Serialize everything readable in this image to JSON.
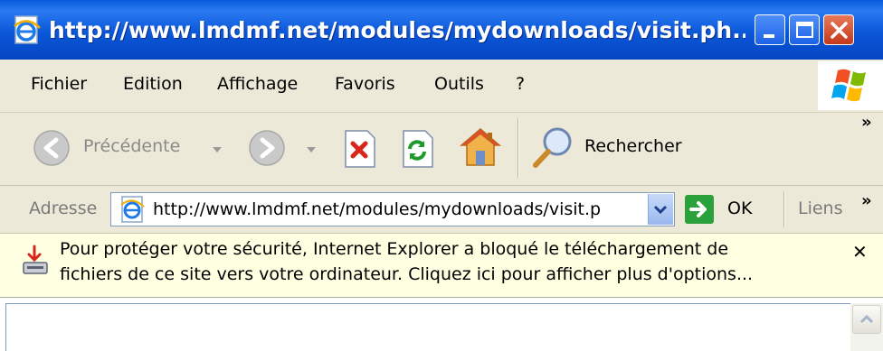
{
  "window": {
    "title": "http://www.lmdmf.net/modules/mydownloads/visit.ph..."
  },
  "menu": {
    "items": [
      "Fichier",
      "Edition",
      "Affichage",
      "Favoris",
      "Outils",
      "?"
    ]
  },
  "toolbar": {
    "back_label": "Précédente",
    "search_label": "Rechercher"
  },
  "address": {
    "label": "Adresse",
    "value": "http://www.lmdmf.net/modules/mydownloads/visit.p",
    "go_label": "OK",
    "links_label": "Liens"
  },
  "infobar": {
    "line1": "Pour protéger votre sécurité, Internet Explorer a bloqué le téléchargement de",
    "line2": "fichiers de ce site vers votre ordinateur. Cliquez ici pour afficher plus d'options...",
    "close_glyph": "✕"
  },
  "chevron_glyph": "»",
  "colors": {
    "titlebar": "#0a57d8",
    "infobar_bg": "#ffffe1",
    "chrome_bg": "#ece9d8"
  }
}
